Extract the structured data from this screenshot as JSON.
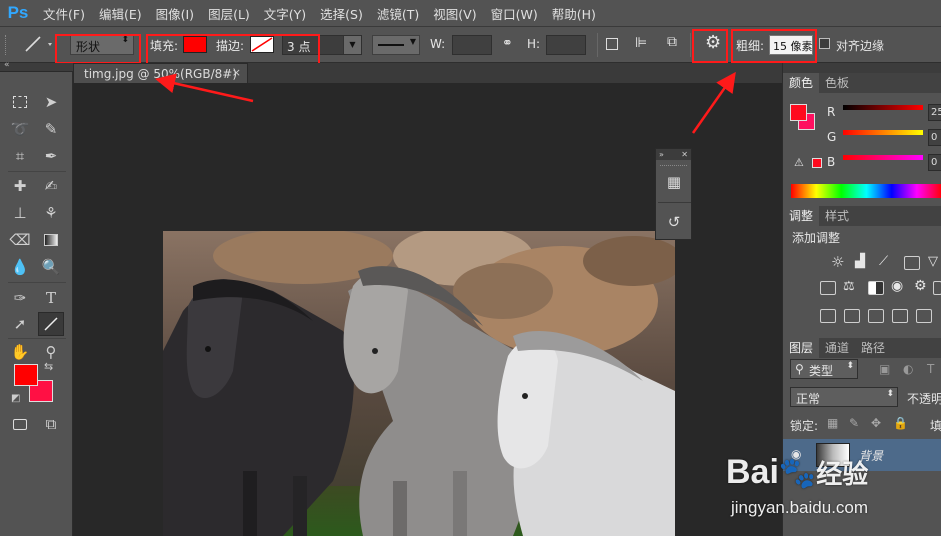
{
  "app": {
    "logo": "Ps"
  },
  "menu": [
    "文件(F)",
    "编辑(E)",
    "图像(I)",
    "图层(L)",
    "文字(Y)",
    "选择(S)",
    "滤镜(T)",
    "视图(V)",
    "窗口(W)",
    "帮助(H)"
  ],
  "options": {
    "mode_value": "形状",
    "fill_label": "填充:",
    "stroke_label": "描边:",
    "stroke_width": "3 点",
    "w_label": "W:",
    "h_label": "H:",
    "weight_label": "粗细:",
    "weight_value": "15 像素",
    "align_edges_label": "对齐边缘",
    "fill_color": "#ff0000",
    "stroke_color": "#ffffff"
  },
  "document": {
    "tab_title": "timg.jpg @ 50%(RGB/8#)",
    "close": "×"
  },
  "color_panel": {
    "tabs": [
      "颜色",
      "色板"
    ],
    "r_label": "R",
    "g_label": "G",
    "b_label": "B",
    "r_value": "25",
    "g_value": "0",
    "b_value": "0",
    "foreground": "#ff0a1e",
    "background": "#ff1060"
  },
  "adjust_panel": {
    "tabs": [
      "调整",
      "样式"
    ],
    "heading": "添加调整"
  },
  "layers_panel": {
    "tabs": [
      "图层",
      "通道",
      "路径"
    ],
    "kind": "类型",
    "blend_mode": "正常",
    "opacity_label": "不透明",
    "lock_label": "锁定:",
    "fill_label": "填",
    "layer_name": "背景"
  },
  "watermark": {
    "brand": "Bai",
    "brand2": "经验",
    "url": "jingyan.baidu.com"
  },
  "toolbox": {
    "foreground": "#ff0000",
    "background": "#ff1044"
  }
}
